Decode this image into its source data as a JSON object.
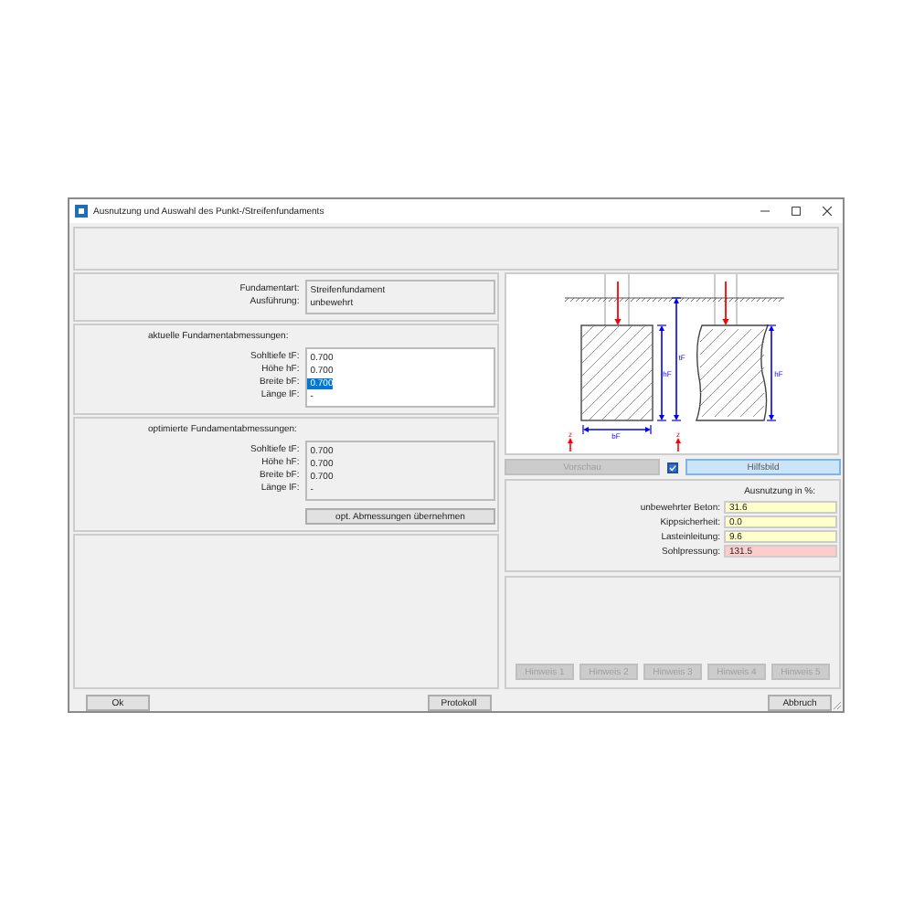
{
  "window": {
    "title": "Ausnutzung und Auswahl des Punkt-/Streifenfundaments"
  },
  "foundation": {
    "rows": [
      {
        "label": "Fundamentart:",
        "value": "Streifenfundament"
      },
      {
        "label": "Ausführung:",
        "value": "unbewehrt"
      }
    ]
  },
  "current": {
    "heading": "aktuelle Fundamentabmessungen:",
    "rows": [
      {
        "label": "Sohltiefe tF:",
        "value": "0.700",
        "selected": false
      },
      {
        "label": "Höhe hF:",
        "value": "0.700",
        "selected": false
      },
      {
        "label": "Breite bF:",
        "value": "0.700",
        "selected": true
      },
      {
        "label": "Länge lF:",
        "value": "-",
        "selected": false
      }
    ]
  },
  "optimized": {
    "heading": "optimierte Fundamentabmessungen:",
    "rows": [
      {
        "label": "Sohltiefe tF:",
        "value": "0.700"
      },
      {
        "label": "Höhe hF:",
        "value": "0.700"
      },
      {
        "label": "Breite bF:",
        "value": "0.700"
      },
      {
        "label": "Länge lF:",
        "value": "-"
      }
    ],
    "button": "opt. Abmessungen übernehmen"
  },
  "diagram": {
    "labels": [
      "hF",
      "bF",
      "tF",
      "hF",
      "z",
      "z"
    ]
  },
  "preview": {
    "label": "Vorschau",
    "disabled": true
  },
  "show_help": {
    "checked": true
  },
  "help_button": {
    "label": "Hilfsbild"
  },
  "utilization": {
    "heading": "Ausnutzung in %:",
    "rows": [
      {
        "label": "unbewehrter Beton:",
        "value": "31.6",
        "color": "#ffffcc"
      },
      {
        "label": "Kippsicherheit:",
        "value": "0.0",
        "color": "#ffffcc"
      },
      {
        "label": "Lasteinleitung:",
        "value": "9.6",
        "color": "#ffffcc"
      },
      {
        "label": "Sohlpressung:",
        "value": "131.5",
        "color": "#ffcccc"
      }
    ]
  },
  "hint_buttons": [
    {
      "label": "Hinweis 1",
      "disabled": true
    },
    {
      "label": "Hinweis 2",
      "disabled": true
    },
    {
      "label": "Hinweis 3",
      "disabled": true
    },
    {
      "label": "Hinweis 4",
      "disabled": true
    },
    {
      "label": "Hinweis 5",
      "disabled": true
    }
  ],
  "footer": {
    "ok": "Ok",
    "protocol": "Protokoll",
    "cancel": "Abbruch"
  }
}
